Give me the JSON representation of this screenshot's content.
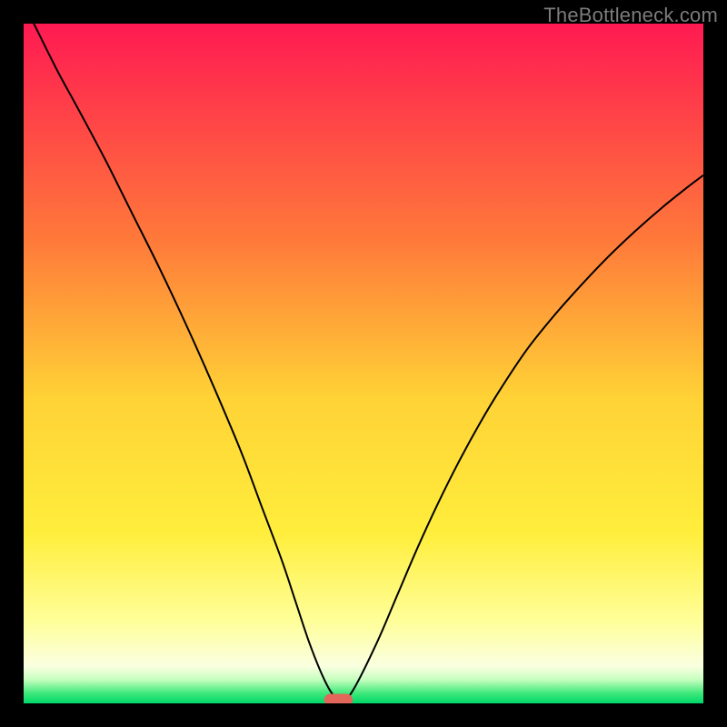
{
  "watermark": "TheBottleneck.com",
  "chart_data": {
    "type": "line",
    "title": "",
    "xlabel": "",
    "ylabel": "",
    "xlim": [
      0,
      100
    ],
    "ylim": [
      0,
      100
    ],
    "grid": false,
    "legend": false,
    "background_gradient": {
      "stops": [
        {
          "offset": 0.0,
          "color": "#ff1a52"
        },
        {
          "offset": 0.32,
          "color": "#ff7a3a"
        },
        {
          "offset": 0.55,
          "color": "#ffd236"
        },
        {
          "offset": 0.75,
          "color": "#ffee3c"
        },
        {
          "offset": 0.88,
          "color": "#ffff9a"
        },
        {
          "offset": 0.945,
          "color": "#faffe0"
        },
        {
          "offset": 0.965,
          "color": "#c6ffbf"
        },
        {
          "offset": 0.985,
          "color": "#3fe87a"
        },
        {
          "offset": 1.0,
          "color": "#00d86a"
        }
      ]
    },
    "series": [
      {
        "name": "bottleneck-curve",
        "stroke": "#000000",
        "stroke_width": 2,
        "x": [
          0,
          2,
          5,
          8,
          12,
          16,
          20,
          24,
          28,
          32,
          35,
          38,
          40,
          42,
          44,
          45.5,
          47,
          48.5,
          52,
          55,
          58,
          61,
          64,
          67,
          70,
          74,
          78,
          82,
          86,
          90,
          94,
          98,
          100
        ],
        "y": [
          103,
          99,
          93,
          87.5,
          80,
          72,
          64,
          55.5,
          46.5,
          37,
          29,
          21,
          15,
          9,
          4,
          1.3,
          0.6,
          2,
          9,
          16,
          23,
          29.5,
          35.5,
          41,
          46,
          52,
          57,
          61.5,
          65.7,
          69.5,
          73,
          76.2,
          77.7
        ]
      }
    ],
    "marker": {
      "name": "operating-point",
      "shape": "rounded-rect",
      "x": 46.3,
      "y": 0.5,
      "width": 4.2,
      "height": 1.8,
      "color": "#e2675a"
    }
  }
}
